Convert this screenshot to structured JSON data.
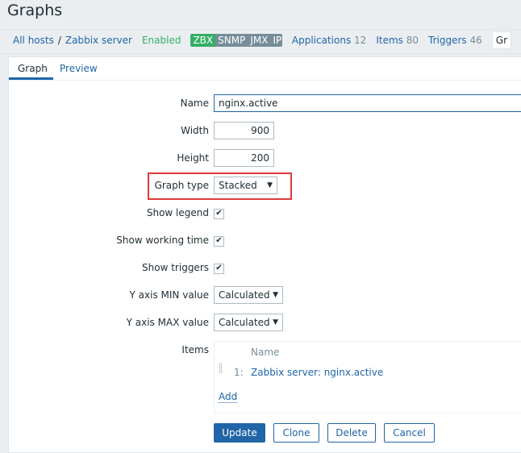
{
  "page_title": "Graphs",
  "breadcrumb": {
    "all_hosts": "All hosts",
    "separator": "/",
    "host": "Zabbix server",
    "status": "Enabled",
    "status_color": "#34af67",
    "badges": [
      "ZBX",
      "SNMP",
      "JMX",
      "IPMI"
    ],
    "links": [
      {
        "label": "Applications",
        "count": "12"
      },
      {
        "label": "Items",
        "count": "80"
      },
      {
        "label": "Triggers",
        "count": "46"
      }
    ],
    "cut_tab": "Gr"
  },
  "tabs": [
    "Graph",
    "Preview"
  ],
  "form": {
    "name_label": "Name",
    "name_value": "nginx.active",
    "width_label": "Width",
    "width_value": "900",
    "height_label": "Height",
    "height_value": "200",
    "graph_type_label": "Graph type",
    "graph_type_value": "Stacked",
    "show_legend_label": "Show legend",
    "show_working_time_label": "Show working time",
    "show_triggers_label": "Show triggers",
    "ymin_label": "Y axis MIN value",
    "ymin_value": "Calculated",
    "ymax_label": "Y axis MAX value",
    "ymax_value": "Calculated",
    "items_label": "Items",
    "items_col_name": "Name",
    "items": [
      {
        "index": "1:",
        "name": "Zabbix server: nginx.active"
      }
    ],
    "add_label": "Add"
  },
  "buttons": {
    "update": "Update",
    "clone": "Clone",
    "delete": "Delete",
    "cancel": "Cancel"
  },
  "highlight_color": "#e03a3a"
}
